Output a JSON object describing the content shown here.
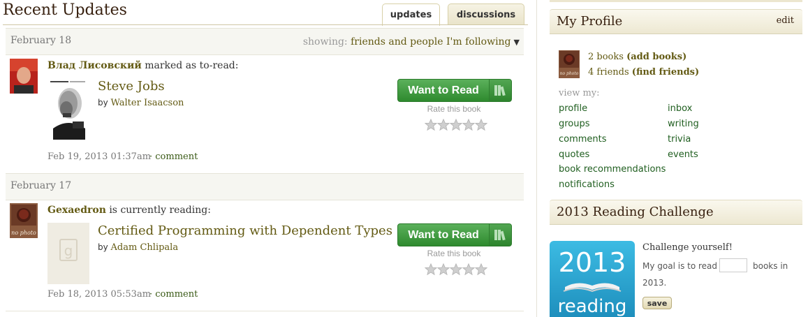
{
  "header": {
    "title": "Recent Updates",
    "tabs": [
      {
        "label": "updates"
      },
      {
        "label": "discussions"
      }
    ]
  },
  "feed": {
    "filter": {
      "prefix": "showing:",
      "value": "friends and people I'm following"
    },
    "groups": [
      {
        "date": "February 18",
        "updates": [
          {
            "actor": "Влад Лисовский",
            "action": "marked as to-read:",
            "book_title": "Steve Jobs",
            "by": "by",
            "author": "Walter Isaacson",
            "button": "Want to Read",
            "rate_label": "Rate this book",
            "timestamp": "Feb 19, 2013 01:37am",
            "comment": "· comment"
          }
        ]
      },
      {
        "date": "February 17",
        "updates": [
          {
            "actor": "Gexaedron",
            "action": "is currently reading:",
            "book_title": "Certified Programming with Dependent Types",
            "by": "by",
            "author": "Adam Chlipala",
            "button": "Want to Read",
            "rate_label": "Rate this book",
            "timestamp": "Feb 18, 2013 05:53am",
            "comment": "· comment",
            "avatar_text": "no photo",
            "cover_letter": "g"
          }
        ]
      }
    ]
  },
  "sidebar": {
    "profile": {
      "title": "My Profile",
      "edit": "edit",
      "avatar_text": "no photo",
      "books": {
        "count": "2 books",
        "action": "(add books)"
      },
      "friends": {
        "count": "4 friends",
        "action": "(find friends)"
      },
      "view_my": "view my:",
      "links_left": [
        "profile",
        "groups",
        "comments",
        "quotes",
        "book recommendations",
        "notifications"
      ],
      "links_right": [
        "inbox",
        "writing",
        "trivia",
        "events"
      ]
    },
    "challenge": {
      "title": "2013 Reading Challenge",
      "image_year": "2013",
      "image_word": "reading",
      "heading": "Challenge yourself!",
      "goal_prefix": "My goal is to read",
      "goal_suffix": "books in",
      "goal_year": "2013.",
      "goal_value": "",
      "save": "save"
    }
  },
  "colors": {
    "accent_text": "#635a13",
    "nav_link": "#1f5e1f",
    "button_green": "#3a9a3a",
    "header_bg": "#ede8d2",
    "challenge_blue": "#2aa7d2"
  }
}
